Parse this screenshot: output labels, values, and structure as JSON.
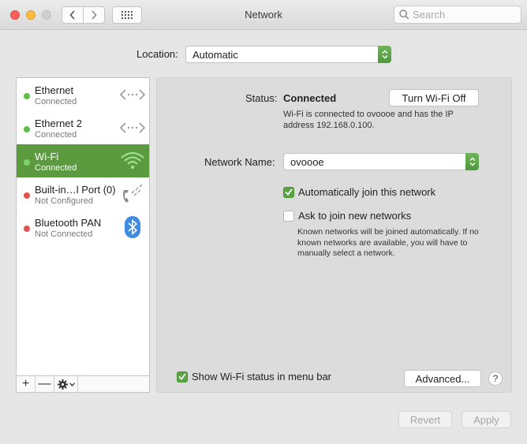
{
  "window": {
    "title": "Network",
    "search_placeholder": "Search"
  },
  "location": {
    "label": "Location:",
    "value": "Automatic"
  },
  "services": [
    {
      "name": "Ethernet",
      "status": "Connected",
      "dot": "green",
      "icon": "ethernet-icon"
    },
    {
      "name": "Ethernet 2",
      "status": "Connected",
      "dot": "green",
      "icon": "ethernet-icon"
    },
    {
      "name": "Wi-Fi",
      "status": "Connected",
      "dot": "green",
      "icon": "wifi-icon",
      "selected": true
    },
    {
      "name": "Built-in…l Port (0)",
      "status": "Not Configured",
      "dot": "red",
      "icon": "phone-modem-icon"
    },
    {
      "name": "Bluetooth PAN",
      "status": "Not Connected",
      "dot": "red",
      "icon": "bluetooth-icon"
    }
  ],
  "sidebar_controls": {
    "add": "+",
    "remove": "—"
  },
  "status": {
    "label": "Status:",
    "value": "Connected",
    "toggle_button": "Turn Wi-Fi Off",
    "description": "Wi-Fi is connected to ovoooe and has the IP address 192.168.0.100."
  },
  "network_name": {
    "label": "Network Name:",
    "value": "ovoooe"
  },
  "options": {
    "auto_join": {
      "label": "Automatically join this network",
      "checked": true
    },
    "ask_join": {
      "label": "Ask to join new networks",
      "checked": false
    },
    "ask_join_description": "Known networks will be joined automatically. If no known networks are available, you will have to manually select a network."
  },
  "footer": {
    "show_status": {
      "label": "Show Wi-Fi status in menu bar",
      "checked": true
    },
    "advanced_button": "Advanced...",
    "help_button": "?",
    "revert_button": "Revert",
    "apply_button": "Apply"
  },
  "colors": {
    "accent_green": "#5b9a3e",
    "checkbox_green": "#5aa642",
    "status_green": "#5ac046",
    "status_red": "#e2544b"
  }
}
